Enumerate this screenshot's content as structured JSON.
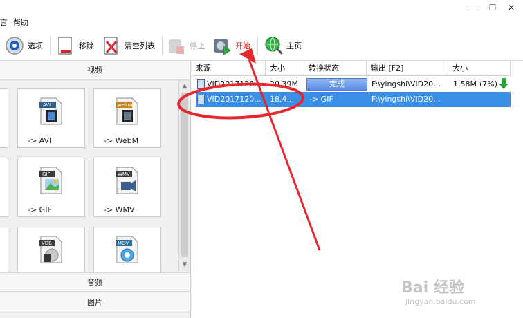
{
  "menubar": {
    "items": [
      "言",
      "帮助"
    ]
  },
  "toolbar": {
    "options_label": "选项",
    "remove_label": "移除",
    "clear_label": "清空列表",
    "stop_label": "停止",
    "start_label": "开始",
    "home_label": "主页"
  },
  "left": {
    "video_header": "视频",
    "audio_header": "音频",
    "image_header": "图片",
    "tiles": [
      {
        "badge": "AVI",
        "label": "-> AVI",
        "color": "#2f5f8a"
      },
      {
        "badge": "webm",
        "label": "-> WebM",
        "color": "#c7832a"
      },
      {
        "badge": "GIF",
        "label": "-> GIF",
        "color": "#3a3a3a"
      },
      {
        "badge": "WMV",
        "label": "-> WMV",
        "color": "#3a3a3a"
      },
      {
        "badge": "VOB",
        "label": "",
        "color": "#3a3a3a"
      },
      {
        "badge": "MOV",
        "label": "",
        "color": "#2d6e9b"
      }
    ]
  },
  "list": {
    "columns": [
      "来源",
      "大小",
      "转换状态",
      "输出 [F2]",
      "大小"
    ],
    "rows": [
      {
        "source": "VID2017120...",
        "size": "20.39M",
        "status": "完成",
        "output": "F:\\yingshi\\VID20...",
        "out_size": "1.58M",
        "percent": "(7%)"
      },
      {
        "source": "VID2017120...",
        "size": "18.4...",
        "status": "-> GIF",
        "output": "F:\\yingshi\\VID20...",
        "out_size": "",
        "percent": ""
      }
    ]
  },
  "watermark": {
    "text": "Bai 经验",
    "sub": "jingyan.baidu.com"
  },
  "colors": {
    "accent": "#e0261d",
    "selection": "#3a8ee6",
    "annotation": "#e8262d"
  }
}
